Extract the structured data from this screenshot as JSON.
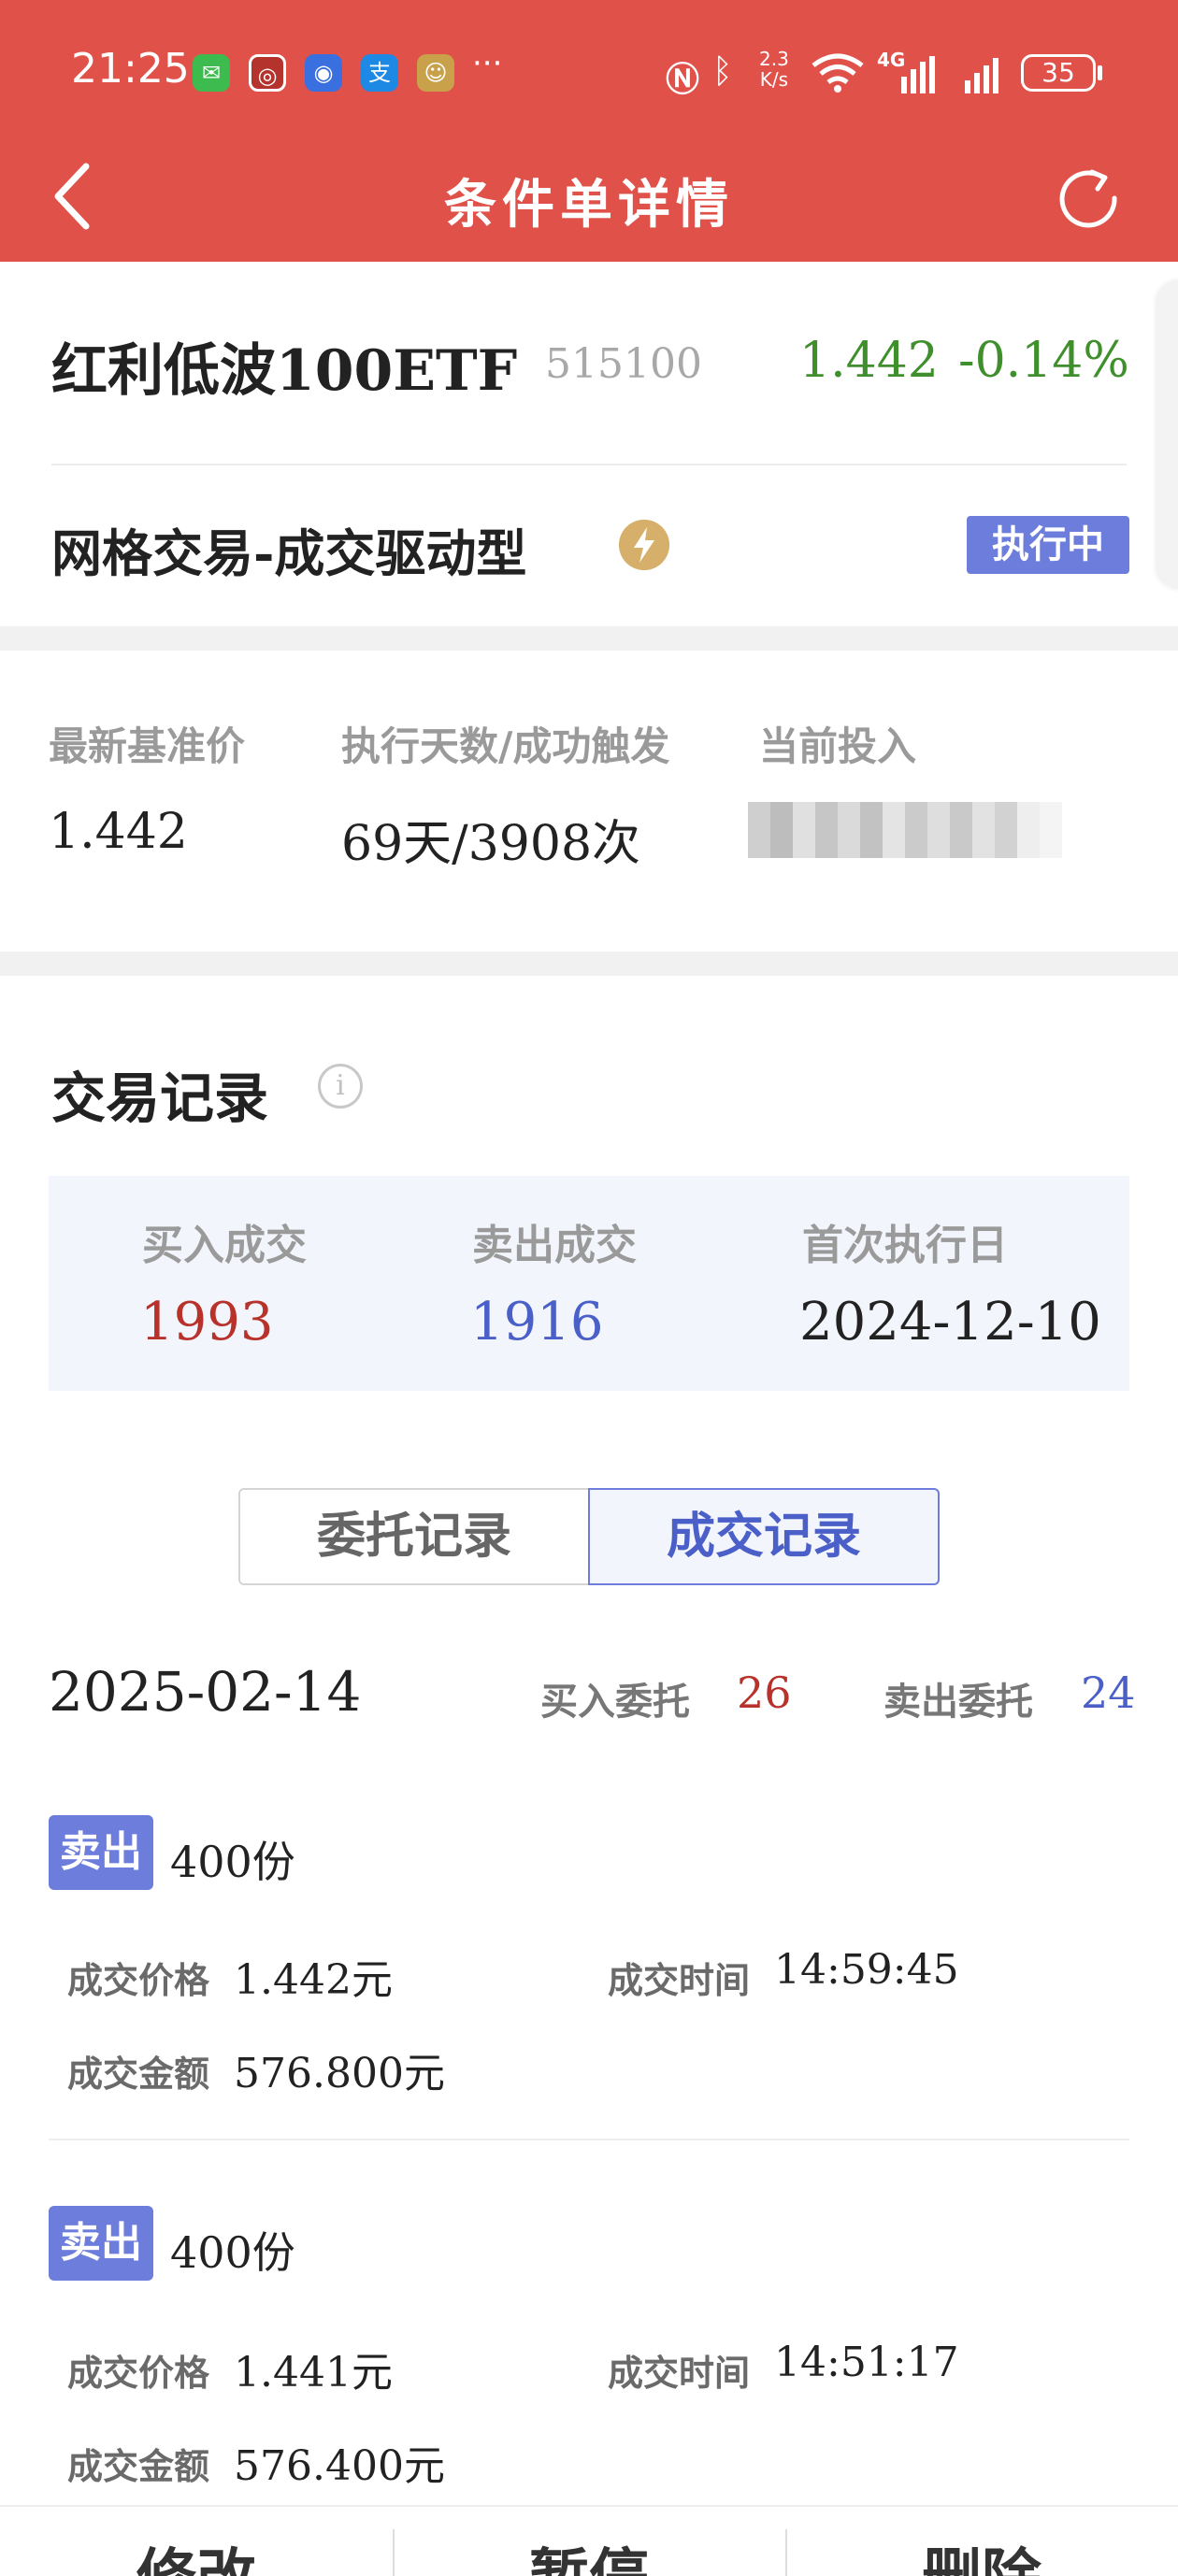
{
  "status_bar": {
    "time": "21:25",
    "net_speed_top": "2.3",
    "net_speed_bottom": "K/s",
    "network": "4G",
    "battery": "35",
    "icons": [
      "wechat-icon",
      "bank-icon",
      "app-icon",
      "alipay-icon",
      "game-icon",
      "more-icon",
      "nfc-icon",
      "bluetooth-icon",
      "wifi-icon",
      "signal-icon"
    ]
  },
  "header": {
    "title": "条件单详情",
    "back_icon": "chevron-left-icon",
    "refresh_icon": "refresh-icon"
  },
  "stock": {
    "name": "红利低波100ETF",
    "code": "515100",
    "price": "1.442",
    "change": "-0.14%",
    "change_color": "#3f8f2c"
  },
  "strategy": {
    "name": "网格交易-成交驱动型",
    "icon": "lightning-icon",
    "status": "执行中",
    "status_color": "#6d7ddc"
  },
  "stats": {
    "base_price_label": "最新基准价",
    "base_price": "1.442",
    "exec_label": "执行天数/成功触发",
    "exec_value": "69天/3908次",
    "invest_label": "当前投入"
  },
  "trade_records": {
    "title": "交易记录",
    "info_icon": "info-icon",
    "buy_label": "买入成交",
    "buy_count": "1993",
    "buy_color": "#c0392b",
    "sell_label": "卖出成交",
    "sell_count": "1916",
    "sell_color": "#4a5fc8",
    "first_date_label": "首次执行日",
    "first_date": "2024-12-10"
  },
  "tabs": {
    "orders": "委托记录",
    "deals": "成交记录",
    "active": "成交记录"
  },
  "day": {
    "date": "2025-02-14",
    "buy_orders_label": "买入委托",
    "buy_orders": "26",
    "sell_orders_label": "卖出委托",
    "sell_orders": "24"
  },
  "records": [
    {
      "side": "卖出",
      "qty": "400份",
      "price_label": "成交价格",
      "price": "1.442元",
      "time_label": "成交时间",
      "time": "14:59:45",
      "amount_label": "成交金额",
      "amount": "576.800元"
    },
    {
      "side": "卖出",
      "qty": "400份",
      "price_label": "成交价格",
      "price": "1.441元",
      "time_label": "成交时间",
      "time": "14:51:17",
      "amount_label": "成交金额",
      "amount": "576.400元"
    }
  ],
  "bottom_bar": {
    "modify": "修改",
    "pause": "暂停",
    "delete": "删除"
  }
}
